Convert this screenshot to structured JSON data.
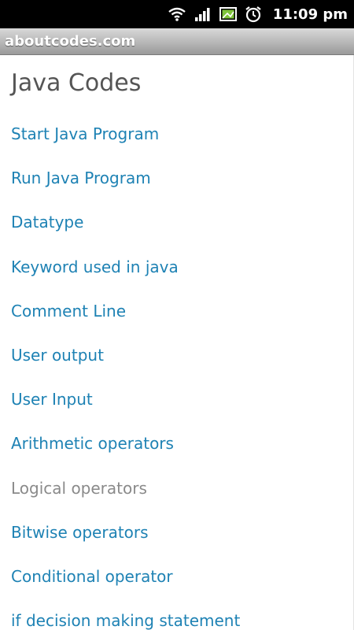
{
  "status_bar": {
    "icons": [
      "wifi-icon",
      "signal-icon",
      "image-icon",
      "alarm-clock-icon"
    ],
    "time": "11:09 pm"
  },
  "app_bar": {
    "title": "aboutcodes.com"
  },
  "page": {
    "heading": "Java Codes",
    "link_color": "#1e82b4",
    "muted_color": "#8a8a8a",
    "items": [
      {
        "label": "Start Java Program"
      },
      {
        "label": "Run Java Program"
      },
      {
        "label": "Datatype"
      },
      {
        "label": "Keyword used in java"
      },
      {
        "label": "Comment Line"
      },
      {
        "label": "User output"
      },
      {
        "label": "User Input"
      },
      {
        "label": "Arithmetic operators"
      },
      {
        "label": "Logical operators"
      },
      {
        "label": "Bitwise operators"
      },
      {
        "label": "Conditional operator"
      },
      {
        "label": "if decision making statement"
      }
    ]
  }
}
